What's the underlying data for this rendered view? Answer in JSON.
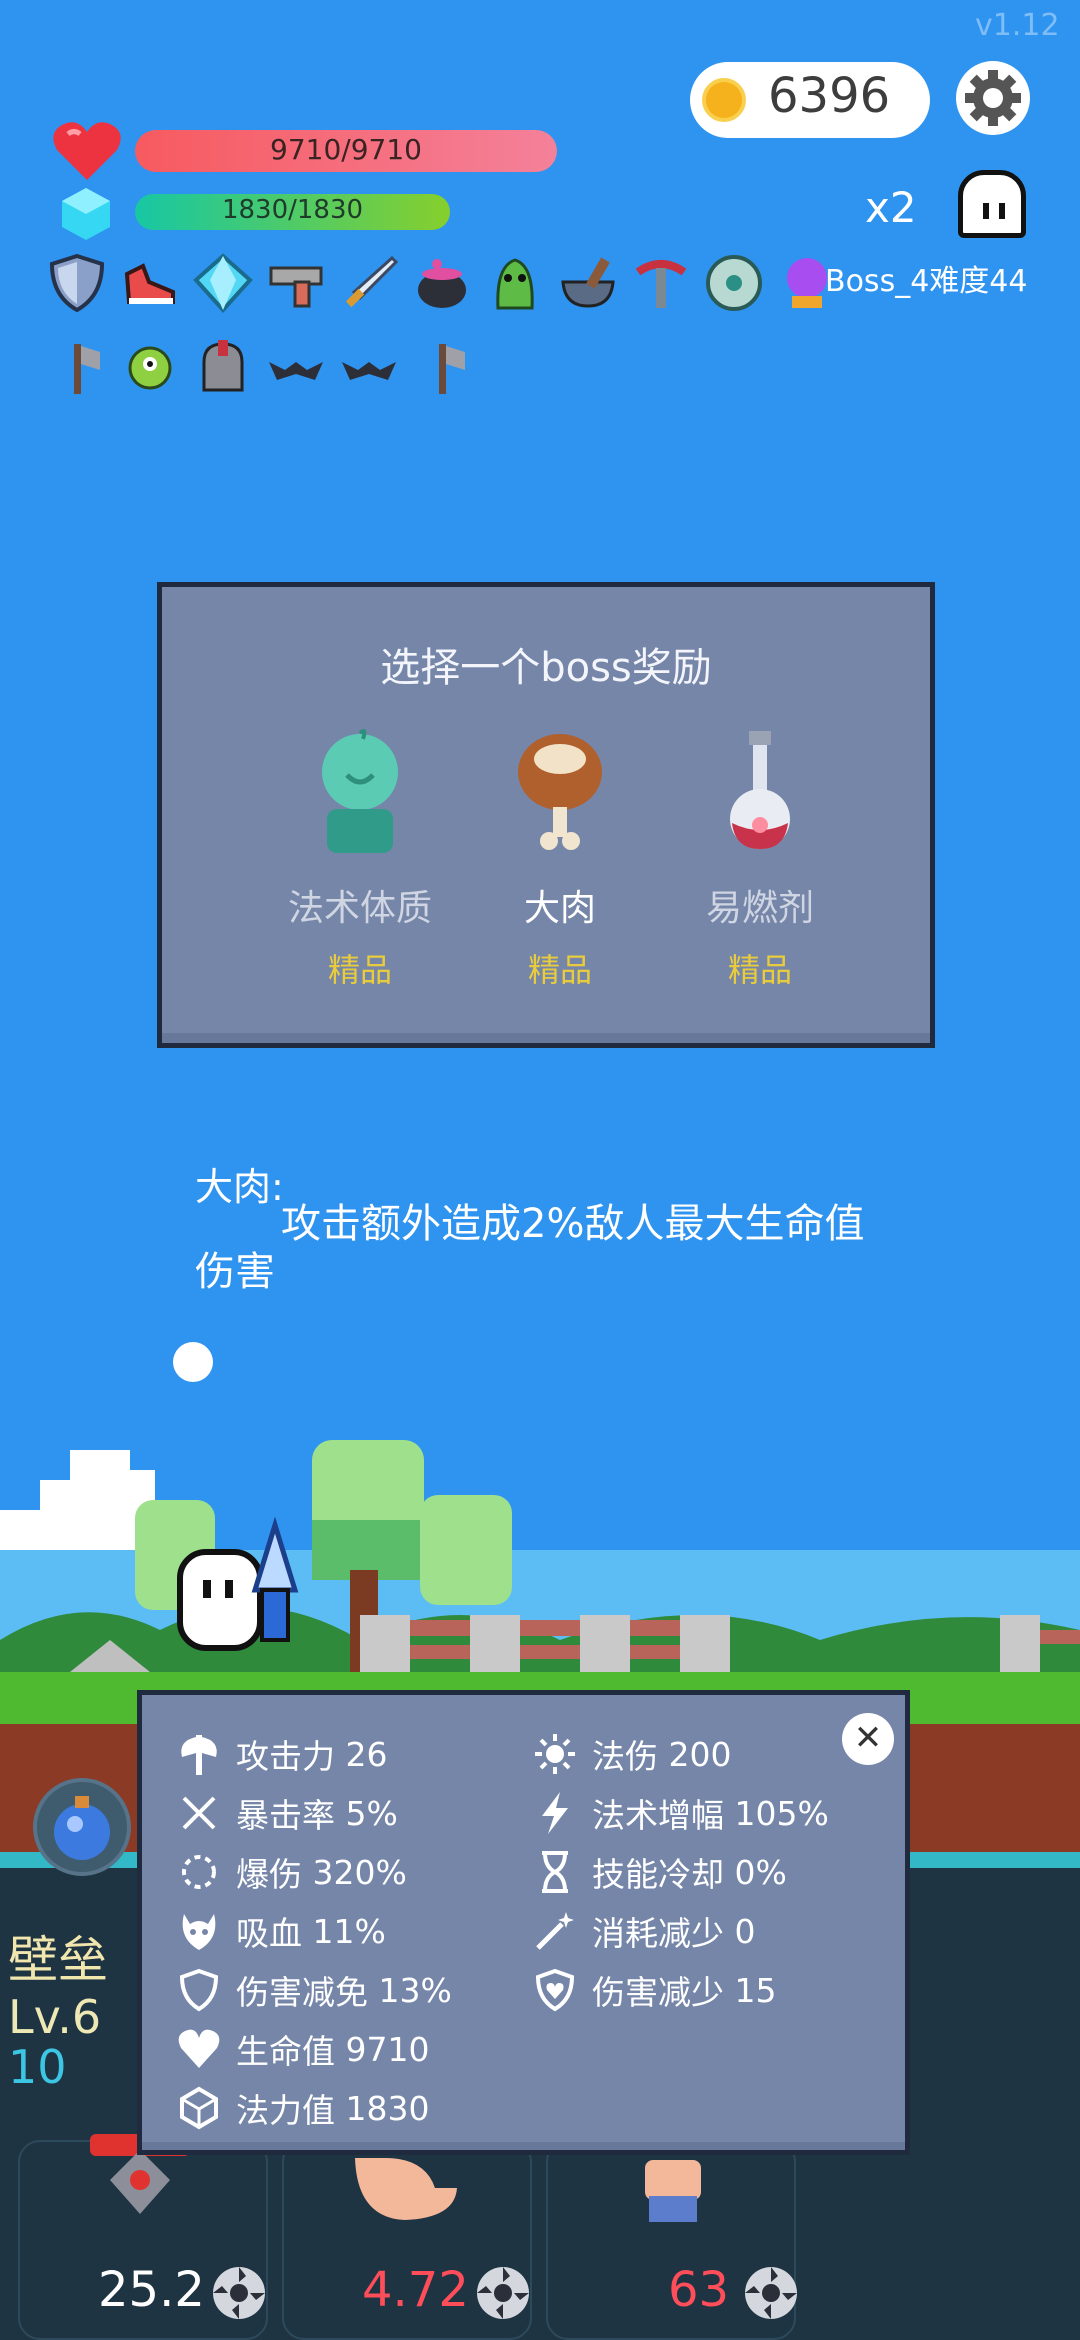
{
  "version": "v1.12",
  "hud": {
    "coins": "6396",
    "hp": "9710/9710",
    "mp": "1830/1830",
    "multiplier": "x2",
    "boss_label": "Boss_4难度44"
  },
  "items_row1": [
    "shield-icon",
    "shoe-icon",
    "diamond-icon",
    "gun-icon",
    "sword-icon",
    "cauldron-icon",
    "goblin-icon",
    "mortar-icon",
    "crossbow-icon",
    "disc-icon",
    "crystal-ball-icon"
  ],
  "items_row2": [
    "axe-icon",
    "monster-icon",
    "helmet-icon",
    "bat-icon",
    "bat-icon",
    "axe-icon"
  ],
  "reward_panel": {
    "title": "选择一个boss奖励",
    "options": [
      {
        "name": "法术体质",
        "tier": "精品",
        "icon": "mage-figure-icon"
      },
      {
        "name": "大肉",
        "tier": "精品",
        "icon": "meat-icon"
      },
      {
        "name": "易燃剂",
        "tier": "精品",
        "icon": "potion-icon"
      }
    ]
  },
  "description": {
    "title": "大肉:",
    "body": "攻击额外造成2%敌人最大生命值伤害"
  },
  "stats": {
    "left": [
      {
        "label": "攻击力",
        "value": "26",
        "icon": "axe-icon"
      },
      {
        "label": "暴击率",
        "value": "5%",
        "icon": "crit-icon"
      },
      {
        "label": "爆伤",
        "value": "320%",
        "icon": "burst-icon"
      },
      {
        "label": "吸血",
        "value": "11%",
        "icon": "skull-icon"
      },
      {
        "label": "伤害减免",
        "value": "13%",
        "icon": "shield-icon"
      },
      {
        "label": "生命值",
        "value": "9710",
        "icon": "heart-icon"
      },
      {
        "label": "法力值",
        "value": "1830",
        "icon": "gem-icon"
      }
    ],
    "right": [
      {
        "label": "法伤",
        "value": "200",
        "icon": "sun-icon"
      },
      {
        "label": "法术增幅",
        "value": "105%",
        "icon": "lightning-icon"
      },
      {
        "label": "技能冷却",
        "value": "0%",
        "icon": "hourglass-icon"
      },
      {
        "label": "消耗减少",
        "value": "0",
        "icon": "wand-icon"
      },
      {
        "label": "伤害减少",
        "value": "15",
        "icon": "shield-heart-icon"
      }
    ]
  },
  "hero": {
    "class_name": "壁垒",
    "level": "Lv.6",
    "level_extra": "10"
  },
  "bottom_values": [
    {
      "value": "25.2",
      "color": "#ffffff"
    },
    {
      "value": "4.72",
      "color": "#ff4d5a"
    },
    {
      "value": "63",
      "color": "#ff4d5a"
    }
  ]
}
